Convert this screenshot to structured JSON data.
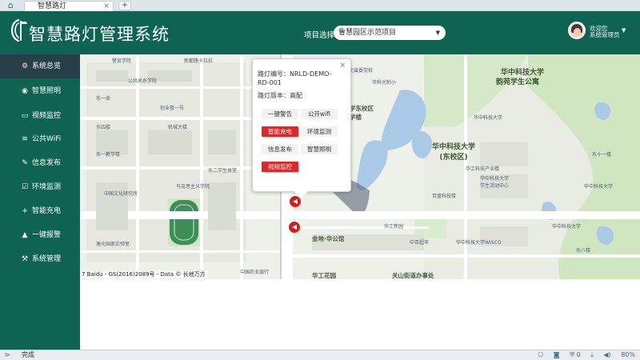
{
  "browser": {
    "tab_title": "智慧路灯",
    "tab_close": "×",
    "new_tab": "+",
    "home_icon": "home-icon"
  },
  "header": {
    "app_title": "智慧路灯管理系统",
    "project_label": "项目选择",
    "project_selected": "鲁慧园区示范项目",
    "welcome_line1": "欢迎您",
    "welcome_line2": "系统管理员",
    "accent": "#0f6352"
  },
  "sidebar": {
    "items": [
      {
        "label": "系统总览",
        "icon": "gear-icon",
        "glyph": "⚙"
      },
      {
        "label": "智慧照明",
        "icon": "bulb-icon",
        "glyph": "💡"
      },
      {
        "label": "视频监控",
        "icon": "monitor-icon",
        "glyph": "▭"
      },
      {
        "label": "公共WiFi",
        "icon": "wifi-icon",
        "glyph": "≋"
      },
      {
        "label": "信息发布",
        "icon": "edit-icon",
        "glyph": "✎"
      },
      {
        "label": "环境监测",
        "icon": "checkbox-icon",
        "glyph": "☑"
      },
      {
        "label": "智能充电",
        "icon": "plus-icon",
        "glyph": "+"
      },
      {
        "label": "一键报警",
        "icon": "warning-icon",
        "glyph": "▲"
      },
      {
        "label": "系统管理",
        "icon": "wrench-icon",
        "glyph": "🔧"
      }
    ],
    "active_index": 0
  },
  "map": {
    "labels": {
      "hust_main": "华中科技大学",
      "yunyuan": "韵苑学生公寓",
      "east_campus": "华中科技大学\n(东校区)",
      "jindi": "金地·华公馆",
      "east_college": "学东校区\n学楼",
      "school_sports": "华中科技大学\n学生活动中心",
      "tongji": "华中科技大学",
      "school": "华科大附中",
      "huazhong_garden": "华工花园",
      "guanshan": "关山街道办事处"
    },
    "copyright": "7 Baidu - GS(2016)2089号 - Data © 长地万方"
  },
  "popup": {
    "close": "×",
    "lamp_id": "路灯编号：NRLD-DEMO-RD-001",
    "lamp_version": "路灯版本：高配",
    "buttons": [
      {
        "label": "一键警告",
        "style": "plain"
      },
      {
        "label": "公开wifi",
        "style": "plain"
      },
      {
        "label": "智能充电",
        "style": "red"
      },
      {
        "label": "环境监测",
        "style": "plain"
      },
      {
        "label": "信息发布",
        "style": "plain"
      },
      {
        "label": "智慧照明",
        "style": "plain"
      },
      {
        "label": "视频监控",
        "style": "red"
      }
    ]
  },
  "status": {
    "text": "完成",
    "zoom": "80%",
    "shield_count": "0",
    "icons": [
      "panel-icon",
      "network-icon",
      "camera-icon",
      "shield-icon",
      "download-icon",
      "speaker-icon"
    ]
  }
}
